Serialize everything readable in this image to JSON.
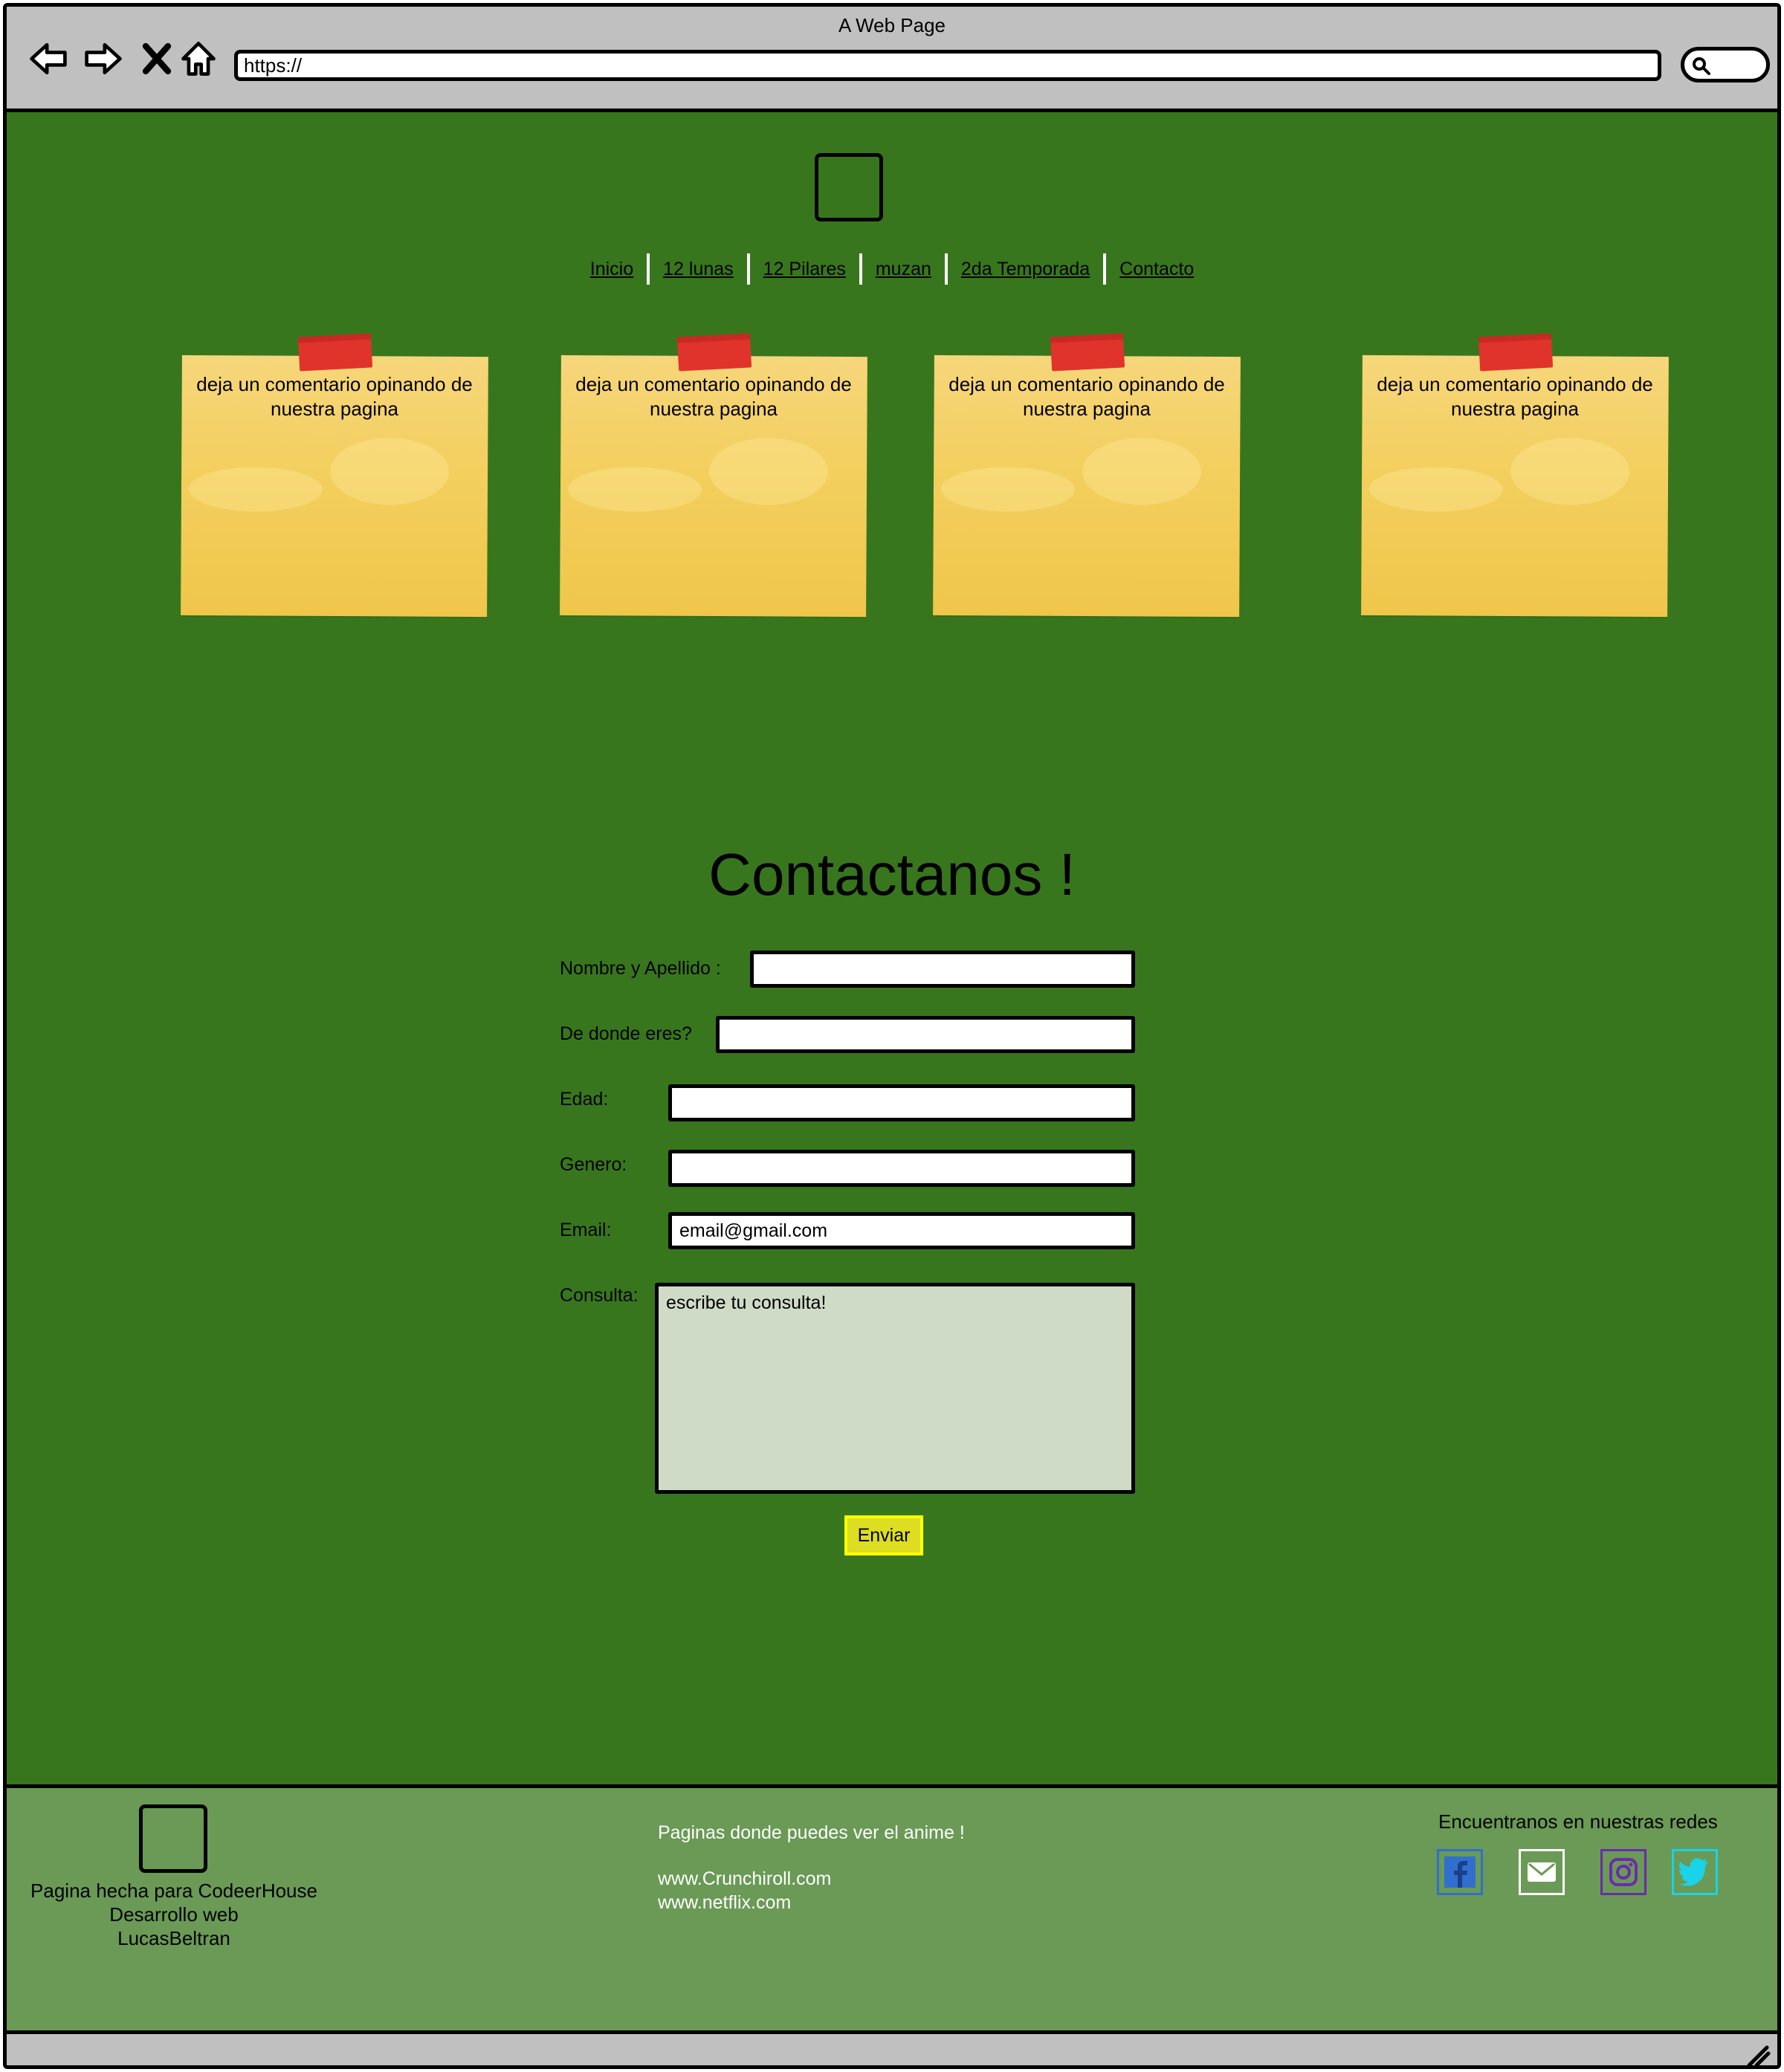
{
  "window": {
    "title": "A Web Page",
    "url": "https://"
  },
  "nav": {
    "items": [
      "Inicio",
      "12 lunas",
      "12 Pilares",
      "muzan",
      "2da Temporada",
      "Contacto"
    ]
  },
  "notes": [
    {
      "text": "deja un comentario opinando de nuestra pagina"
    },
    {
      "text": "deja un comentario opinando de nuestra pagina"
    },
    {
      "text": "deja un comentario opinando de nuestra pagina"
    },
    {
      "text": "deja un comentario opinando de nuestra pagina"
    }
  ],
  "contact": {
    "title": "Contactanos !",
    "name_label": "Nombre y Apellido :",
    "name_value": "",
    "origin_label": "De donde eres?",
    "origin_value": "",
    "age_label": "Edad:",
    "age_value": "",
    "gender_label": "Genero:",
    "gender_value": "",
    "email_label": "Email:",
    "email_value": "email@gmail.com",
    "query_label": "Consulta:",
    "query_value": "escribe tu consulta!",
    "submit_label": "Enviar"
  },
  "footer": {
    "left_lines": [
      "Pagina hecha para CodeerHouse",
      "Desarrollo web",
      "LucasBeltran"
    ],
    "mid_heading": "Paginas donde puedes ver el anime !",
    "mid_links": [
      "www.Crunchiroll.com",
      "www.netflix.com"
    ],
    "right_title": "Encuentranos en nuestras redes",
    "social_icons": [
      "facebook-icon",
      "email-icon",
      "instagram-icon",
      "twitter-icon"
    ]
  },
  "colors": {
    "page_bg": "#38761d",
    "footer_bg": "#6a9a55",
    "note_yellow": "#f3cf5e",
    "tape_red": "#e0332b",
    "submit_bg": "#dddd22",
    "textarea_bg": "#cfdbc6",
    "facebook": "#2f6fd0",
    "email": "#ffffff",
    "instagram": "#6a2bb0",
    "twitter": "#19d3e8"
  }
}
